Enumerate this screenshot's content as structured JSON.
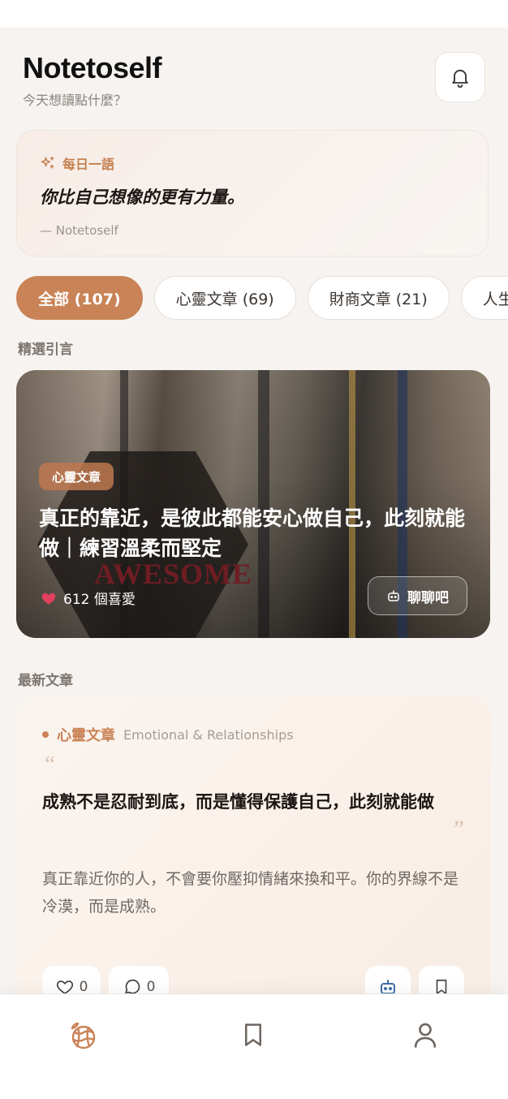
{
  "header": {
    "title": "Notetoself",
    "subtitle": "今天想讀點什麼？"
  },
  "daily": {
    "label": "每日一語",
    "quote": "你比自己想像的更有力量。",
    "author": "— Notetoself"
  },
  "chips": [
    {
      "label": "全部 (107)",
      "active": true
    },
    {
      "label": "心靈文章 (69)",
      "active": false
    },
    {
      "label": "財商文章 (21)",
      "active": false
    },
    {
      "label": "人生文",
      "active": false
    }
  ],
  "featured_section": {
    "label": "精選引言",
    "category": "心靈文章",
    "title": "真正的靠近，是彼此都能安心做自己，此刻就能做｜練習溫柔而堅定",
    "likes": "612 個喜愛",
    "chat_label": "聊聊吧",
    "image_sign_text": "AWESOME"
  },
  "latest_section": {
    "label": "最新文章",
    "category": "心靈文章",
    "subcategory": "Emotional & Relationships",
    "quote_open": "“",
    "title": "成熟不是忍耐到底，而是懂得保護自己，此刻就能做",
    "quote_close": "”",
    "body": "真正靠近你的人，不會要你壓抑情緒來換和平。你的界線不是冷漠，而是成熟。",
    "like_count": "0",
    "comment_count": "0"
  },
  "bottom_nav": {
    "items": [
      "home-icon",
      "bookmark-icon",
      "profile-icon"
    ]
  },
  "colors": {
    "accent": "#c98356",
    "background": "#f6f3f0"
  }
}
